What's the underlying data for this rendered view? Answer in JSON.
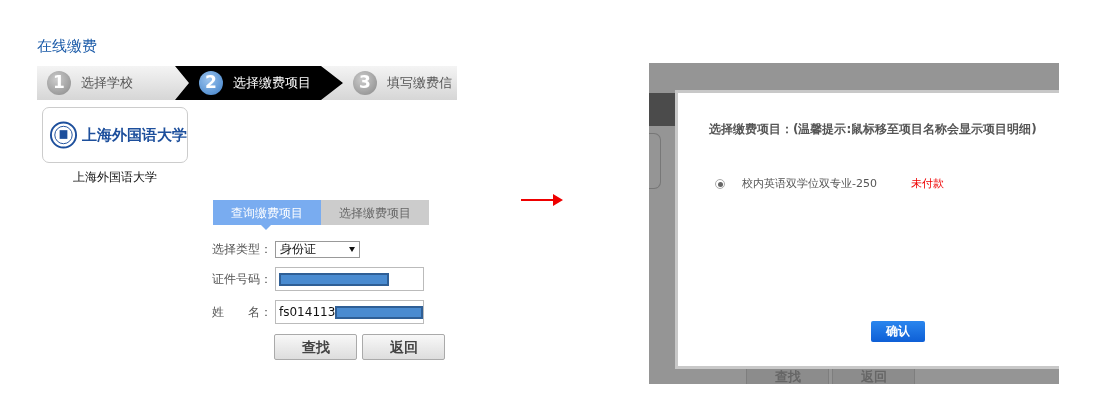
{
  "page_title": "在线缴费",
  "steps": [
    {
      "number": "1",
      "label": "选择学校",
      "selected": false
    },
    {
      "number": "2",
      "label": "选择缴费项目",
      "selected": true
    },
    {
      "number": "3",
      "label": "填写缴费信",
      "selected": false
    }
  ],
  "school": {
    "logo_wordmark": "上海外国语大学",
    "name": "上海外国语大学"
  },
  "tabs": [
    {
      "label": "查询缴费项目",
      "selected": true
    },
    {
      "label": "选择缴费项目",
      "selected": false
    }
  ],
  "form": {
    "fields": [
      {
        "kind": "select",
        "label": "选择类型：",
        "value": "身份证"
      },
      {
        "kind": "input",
        "label": "证件号码：",
        "redacted": true
      },
      {
        "kind": "input",
        "label": "姓　　名：",
        "value": "fs014113",
        "redacted": true
      }
    ],
    "buttons": [
      "查找",
      "返回"
    ]
  },
  "dialog": {
    "background_buttons": [
      "查找",
      "返回"
    ],
    "title": "选择缴费项目：(温馨提示:鼠标移至项目名称会显示项目明细)",
    "items": [
      {
        "label": "校内英语双学位双专业-250",
        "status": "未付款",
        "selected": true
      }
    ],
    "confirm": "确认"
  }
}
